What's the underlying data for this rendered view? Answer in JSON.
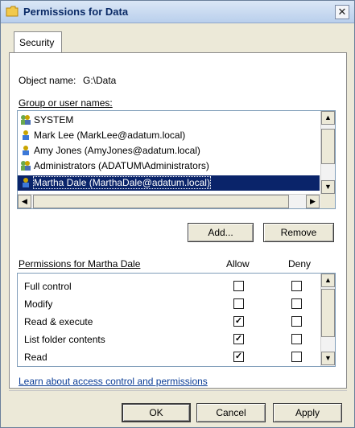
{
  "window": {
    "title": "Permissions for Data"
  },
  "tabs": [
    {
      "label": "Security"
    }
  ],
  "object_name": {
    "label": "Object name:",
    "value": "G:\\Data"
  },
  "group_list": {
    "label": "Group or user names:",
    "items": [
      {
        "name": "SYSTEM",
        "icon": "group-icon",
        "selected": false
      },
      {
        "name": "Mark Lee (MarkLee@adatum.local)",
        "icon": "user-icon",
        "selected": false
      },
      {
        "name": "Amy Jones (AmyJones@adatum.local)",
        "icon": "user-icon",
        "selected": false
      },
      {
        "name": "Administrators (ADATUM\\Administrators)",
        "icon": "group-icon",
        "selected": false
      },
      {
        "name": "Martha Dale (MarthaDale@adatum.local)",
        "icon": "user-icon",
        "selected": true
      }
    ]
  },
  "buttons": {
    "add": "Add...",
    "remove": "Remove",
    "ok": "OK",
    "cancel": "Cancel",
    "apply": "Apply"
  },
  "permissions": {
    "header": "Permissions for Martha Dale",
    "allow_header": "Allow",
    "deny_header": "Deny",
    "rows": [
      {
        "name": "Full control",
        "allow": false,
        "deny": false
      },
      {
        "name": "Modify",
        "allow": false,
        "deny": false
      },
      {
        "name": "Read & execute",
        "allow": true,
        "deny": false
      },
      {
        "name": "List folder contents",
        "allow": true,
        "deny": false
      },
      {
        "name": "Read",
        "allow": true,
        "deny": false
      }
    ]
  },
  "learn_link": "Learn about access control and permissions",
  "colors": {
    "selection": "#0a246a",
    "link": "#0a3c96"
  }
}
